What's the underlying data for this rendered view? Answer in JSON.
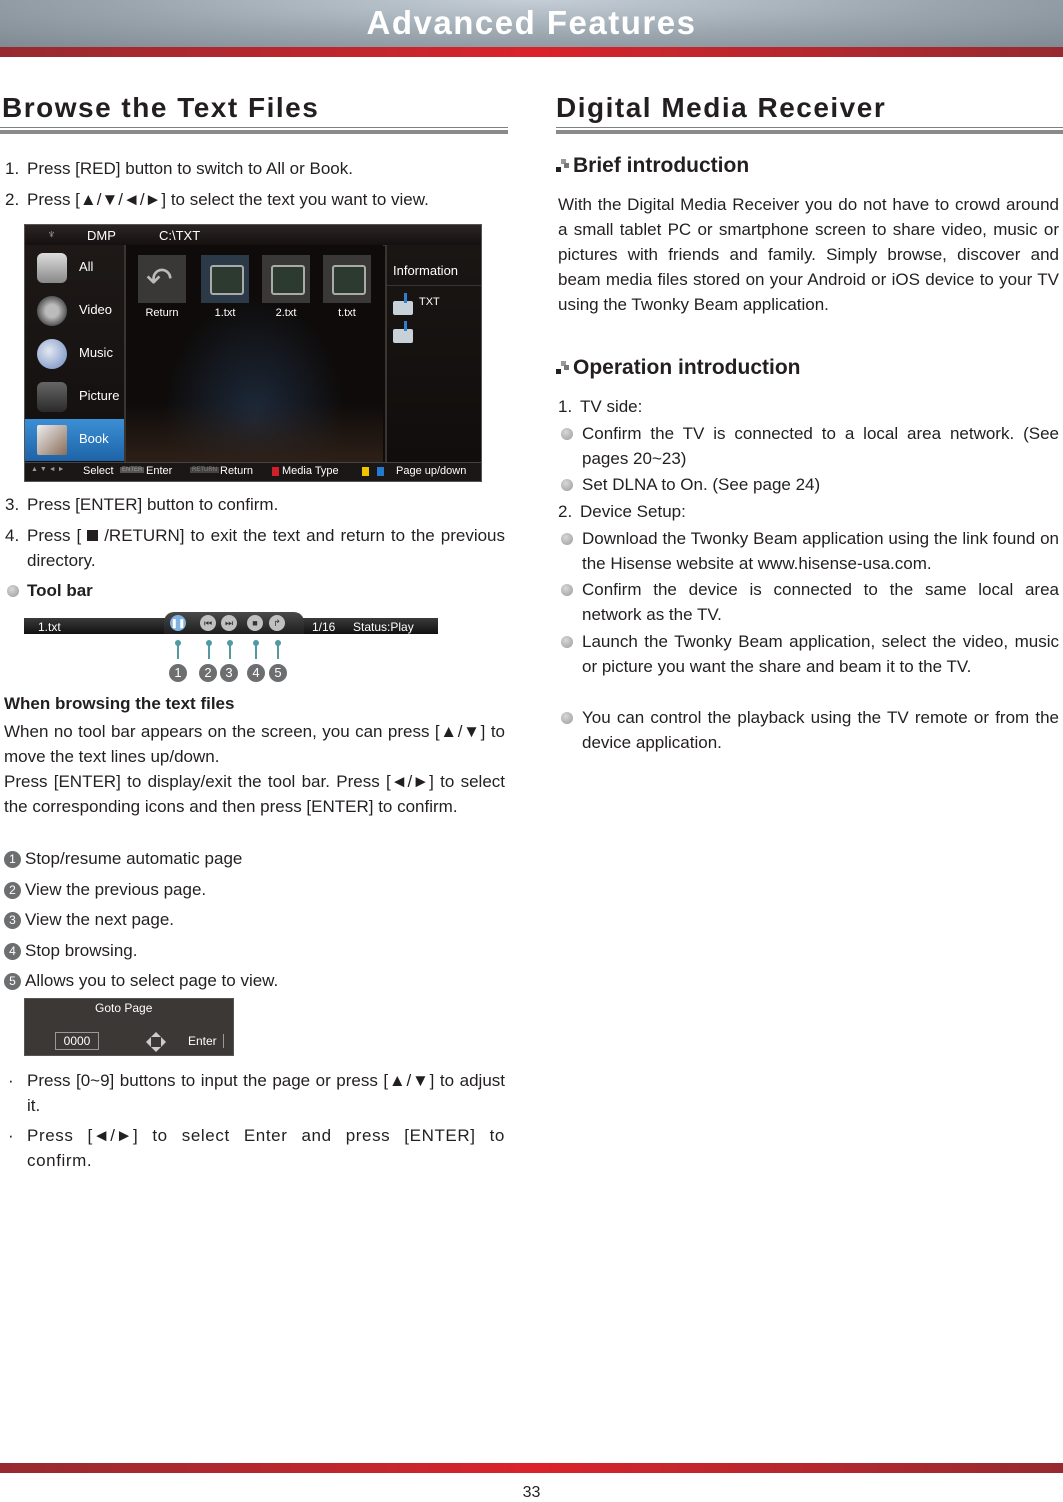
{
  "header": {
    "title": "Advanced Features"
  },
  "left": {
    "section_title": "Browse the Text Files",
    "steps_a": [
      {
        "num": "1.",
        "text": "Press [RED] button to switch to All or Book."
      },
      {
        "num": "2.",
        "text": "Press [▲/▼/◄/►] to select the text you want to view."
      }
    ],
    "tv_screen": {
      "top_label": "DMP",
      "path": "C:\\TXT",
      "categories": [
        "All",
        "Video",
        "Music",
        "Picture",
        "Book"
      ],
      "active_category": "Book",
      "tiles": [
        "Return",
        "1.txt",
        "2.txt",
        "t.txt"
      ],
      "info_title": "Information",
      "info_type": "TXT",
      "hints": {
        "select": "Select",
        "enter_key": "ENTER",
        "enter": "Enter",
        "return_key": "RETURN",
        "return": "Return",
        "media_type": "Media Type",
        "page": "Page up/down"
      },
      "colors": {
        "red": "#d0202a",
        "yellow": "#f2c200",
        "blue": "#2479d0",
        "active": "#2f7ac6"
      }
    },
    "steps_b": [
      {
        "num": "3.",
        "text": "Press [ENTER] button to confirm."
      },
      {
        "num": "4.",
        "text_pre": "Press [ ",
        "text_post": " /RETURN] to exit the text and return to the previous directory."
      }
    ],
    "toolbar_heading": "Tool bar",
    "toolbar": {
      "file": "1.txt",
      "page": "1/16",
      "status": "Status:Play",
      "callouts": [
        "1",
        "2",
        "3",
        "4",
        "5"
      ]
    },
    "browsing_heading": "When browsing the text files",
    "browsing_p1": "When no tool bar appears on the screen, you can press [▲/▼] to move the text lines up/down.",
    "browsing_p2": "Press [ENTER] to display/exit the tool bar. Press [◄/►] to select the corresponding icons and then press [ENTER] to confirm.",
    "functions": [
      {
        "num": "1",
        "text": "Stop/resume automatic page"
      },
      {
        "num": "2",
        "text": "View the previous page."
      },
      {
        "num": "3",
        "text": "View the next page."
      },
      {
        "num": "4",
        "text": "Stop browsing."
      },
      {
        "num": "5",
        "text": "Allows you to select page to view."
      }
    ],
    "goto": {
      "title": "Goto Page",
      "value": "0000",
      "enter": "Enter"
    },
    "notes": [
      "Press [0~9] buttons to input the page or press [▲/▼] to adjust it.",
      "Press [◄/►] to select Enter and press [ENTER] to confirm."
    ],
    "note_bullet": "·"
  },
  "right": {
    "section_title": "Digital Media Receiver",
    "brief_heading": "Brief introduction",
    "brief_text": "With the Digital Media Receiver you do not have to crowd around a small tablet PC or smartphone screen to share video, music or pictures with friends and family.  Simply browse, discover and beam media files stored on your Android or iOS device to your TV using the Twonky Beam application.",
    "operation_heading": "Operation introduction",
    "tv_side": {
      "num": "1.",
      "label": "TV side:"
    },
    "tv_bullets": [
      "Confirm the TV is connected to a local area network. (See pages 20~23)",
      "Set DLNA to On. (See page 24)"
    ],
    "device_setup": {
      "num": "2.",
      "label": "Device Setup:"
    },
    "device_bullets": [
      "Download the Twonky Beam application using the link found on the Hisense website at www.hisense-usa.com.",
      "Confirm the device is connected to the same local area network as the TV.",
      "Launch the Twonky Beam application, select the video, music or picture you want the share and beam it to the TV.",
      "You can control the playback using the TV remote or from the device application."
    ]
  },
  "footer": {
    "page_number": "33"
  }
}
